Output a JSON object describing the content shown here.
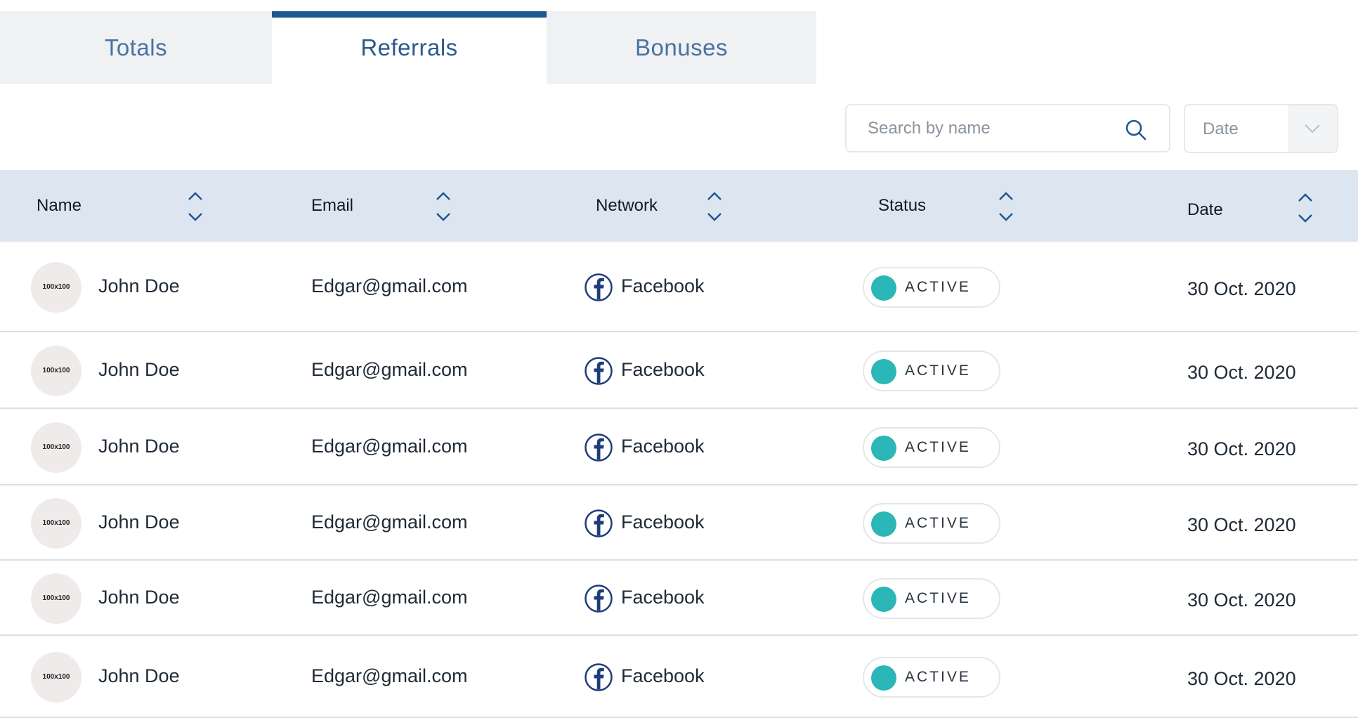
{
  "tabs": [
    {
      "label": "Totals"
    },
    {
      "label": "Referrals"
    },
    {
      "label": "Bonuses"
    }
  ],
  "active_tab": "Referrals",
  "accent_color": "#1e5692",
  "status_color": "#2bb6b8",
  "search": {
    "placeholder": "Search by name",
    "value": ""
  },
  "date_filter": {
    "label": "Date"
  },
  "table": {
    "columns": [
      "Name",
      "Email",
      "Network",
      "Status",
      "Date"
    ],
    "rows": [
      {
        "avatar": "100x100",
        "name": "John Doe",
        "email": "Edgar@gmail.com",
        "network": "Facebook",
        "status": "ACTIVE",
        "date": "30 Oct. 2020"
      },
      {
        "avatar": "100x100",
        "name": "John Doe",
        "email": "Edgar@gmail.com",
        "network": "Facebook",
        "status": "ACTIVE",
        "date": "30 Oct. 2020"
      },
      {
        "avatar": "100x100",
        "name": "John Doe",
        "email": "Edgar@gmail.com",
        "network": "Facebook",
        "status": "ACTIVE",
        "date": "30 Oct. 2020"
      },
      {
        "avatar": "100x100",
        "name": "John Doe",
        "email": "Edgar@gmail.com",
        "network": "Facebook",
        "status": "ACTIVE",
        "date": "30 Oct. 2020"
      },
      {
        "avatar": "100x100",
        "name": "John Doe",
        "email": "Edgar@gmail.com",
        "network": "Facebook",
        "status": "ACTIVE",
        "date": "30 Oct. 2020"
      },
      {
        "avatar": "100x100",
        "name": "John Doe",
        "email": "Edgar@gmail.com",
        "network": "Facebook",
        "status": "ACTIVE",
        "date": "30 Oct. 2020"
      }
    ]
  }
}
